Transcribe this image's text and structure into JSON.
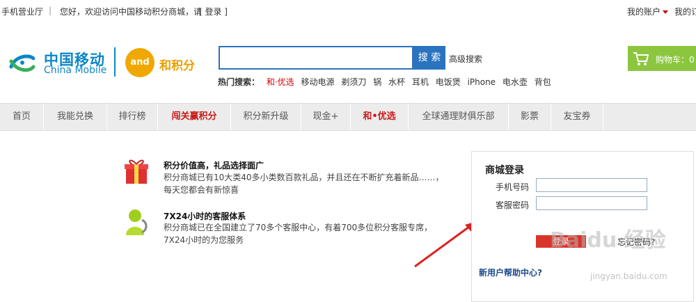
{
  "topbar": {
    "hall": "手机营业厅",
    "divider": "|",
    "greeting": "您好，欢迎访问中国移动积分商城，请",
    "login_link": "[ 登录 ]",
    "account": "我的账户",
    "mine": "我的订"
  },
  "logo": {
    "cn": "中国移动",
    "en": "China Mobile",
    "and_mark": "and",
    "points": "和积分"
  },
  "search": {
    "placeholder": "",
    "button": "搜 索",
    "advanced": "高级搜索",
    "hot_label": "热门搜索：",
    "hot_items": [
      "和·优选",
      "移动电源",
      "剃须刀",
      "锅",
      "水杯",
      "耳机",
      "电饭煲",
      "iPhone",
      "电水壶",
      "背包"
    ]
  },
  "cart": {
    "label": "购物车：0"
  },
  "nav": {
    "items": [
      "首页",
      "我能兑换",
      "排行榜",
      "闯关赢积分",
      "积分新升级",
      "现金+",
      "和•优选",
      "全球通理财俱乐部",
      "影票",
      "友宝券"
    ]
  },
  "features": [
    {
      "title": "积分价值高，礼品选择面广",
      "line1": "积分商城已有10大类40多小类数百款礼品，并且还在不断扩充着新品……，",
      "line2": "每天您都会有新惊喜"
    },
    {
      "title": "7X24小时的客服体系",
      "line1": "积分商城已在全国建立了70多个客服中心，有着700多位积分客服专席，",
      "line2": "7X24小时的为您服务"
    }
  ],
  "login": {
    "title": "商城登录",
    "phone_label": "手机号码",
    "phone_value": "",
    "pwd_label": "客服密码",
    "pwd_value": "",
    "submit": "登录",
    "forgot": "忘记密码?",
    "help": "新用户帮助中心?"
  },
  "watermark": {
    "main": "Baidu 经验",
    "url": "jingyan.baidu.com"
  },
  "colors": {
    "brand_blue": "#0b86c8",
    "search_blue": "#2a73bf",
    "cart_green": "#8cc63f",
    "nav_hot_red": "#c81818",
    "login_red": "#d9342b"
  }
}
